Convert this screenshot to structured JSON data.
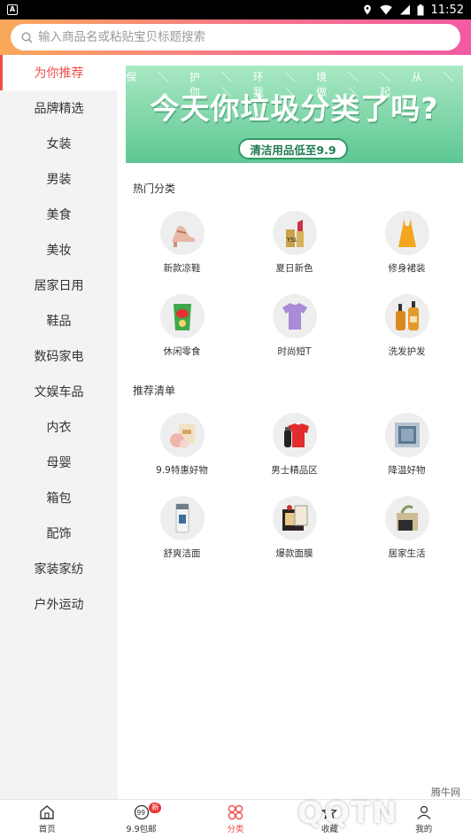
{
  "status_bar": {
    "time": "11:52"
  },
  "search": {
    "placeholder": "输入商品名或粘贴宝贝标题搜索"
  },
  "sidebar": {
    "items": [
      {
        "label": "为你推荐",
        "active": true
      },
      {
        "label": "品牌精选"
      },
      {
        "label": "女装"
      },
      {
        "label": "男装"
      },
      {
        "label": "美食"
      },
      {
        "label": "美妆"
      },
      {
        "label": "居家日用"
      },
      {
        "label": "鞋品"
      },
      {
        "label": "数码家电"
      },
      {
        "label": "文娱车品"
      },
      {
        "label": "内衣"
      },
      {
        "label": "母婴"
      },
      {
        "label": "箱包"
      },
      {
        "label": "配饰"
      },
      {
        "label": "家装家纺"
      },
      {
        "label": "户外运动"
      }
    ]
  },
  "banner": {
    "top_text": "保 ＼ 护 ＼ 环 ＼ 境 ＼ ＼ 从 ＼ 你 ＼ 我 ＼ 做 ＼ 起",
    "title": "今天你垃圾分类了吗?",
    "pill": "清洁用品低至9.9",
    "colors": {
      "top": "#a9e8c4",
      "bottom": "#5ec793"
    }
  },
  "hot": {
    "title": "热门分类",
    "items": [
      {
        "label": "新款凉鞋",
        "icon": "sandal-icon"
      },
      {
        "label": "夏日新色",
        "icon": "lipstick-icon"
      },
      {
        "label": "修身裙装",
        "icon": "dress-icon"
      },
      {
        "label": "休闲零食",
        "icon": "chips-icon"
      },
      {
        "label": "时尚短T",
        "icon": "tshirt-icon"
      },
      {
        "label": "洗发护发",
        "icon": "shampoo-icon"
      }
    ]
  },
  "recommend": {
    "title": "推荐清单",
    "items": [
      {
        "label": "9.9特惠好物",
        "icon": "gift-box-icon"
      },
      {
        "label": "男士精品区",
        "icon": "shaver-icon"
      },
      {
        "label": "降温好物",
        "icon": "cooling-mat-icon"
      },
      {
        "label": "舒爽洁面",
        "icon": "cleanser-icon"
      },
      {
        "label": "爆款面膜",
        "icon": "face-mask-icon"
      },
      {
        "label": "居家生活",
        "icon": "home-goods-icon"
      }
    ]
  },
  "bottom_nav": {
    "items": [
      {
        "label": "首页",
        "icon": "home-icon"
      },
      {
        "label": "9.9包邮",
        "icon": "nine-nine-icon",
        "badge": "新"
      },
      {
        "label": "分类",
        "icon": "category-icon",
        "active": true
      },
      {
        "label": "收藏",
        "icon": "star-icon"
      },
      {
        "label": "我的",
        "icon": "user-icon"
      }
    ]
  },
  "watermark": {
    "text": "腾牛网",
    "logo": "QQTN"
  },
  "colors": {
    "accent": "#ef4d4d",
    "header_left": "#f8a95a",
    "header_right": "#f25aa3"
  }
}
